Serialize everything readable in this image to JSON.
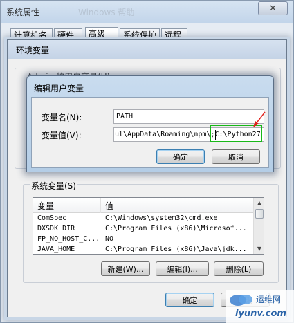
{
  "system_properties": {
    "title": "系统属性",
    "ghost_text": "Windows 帮助",
    "close_glyph": "✕",
    "tabs": [
      {
        "label": "计算机名"
      },
      {
        "label": "硬件"
      },
      {
        "label": "高级"
      },
      {
        "label": "系统保护"
      },
      {
        "label": "远程"
      }
    ],
    "active_tab": "高级"
  },
  "environment_variables": {
    "title": "环境变量",
    "user_group_label": "Admin 的用户变量(U)",
    "system_group_label": "系统变量(S)",
    "system_table": {
      "columns": [
        "变量",
        "值"
      ],
      "rows": [
        {
          "name": "ComSpec",
          "value": "C:\\Windows\\system32\\cmd.exe"
        },
        {
          "name": "DXSDK_DIR",
          "value": "C:\\Program Files (x86)\\Microsof..."
        },
        {
          "name": "FP_NO_HOST_C...",
          "value": "NO"
        },
        {
          "name": "JAVA_HOME",
          "value": "C:\\Program Files (x86)\\Java\\jdk..."
        }
      ]
    },
    "buttons": {
      "new": "新建(W)...",
      "edit": "编辑(I)...",
      "delete": "删除(L)",
      "ok": "确定",
      "cancel": "取消"
    }
  },
  "edit_user_variable": {
    "title": "编辑用户变量",
    "name_label": "变量名(N):",
    "name_value": "PATH",
    "value_label": "变量值(V):",
    "value_text": "ul\\AppData\\Roaming\\npm\\;C:\\Python27",
    "ok_label": "确定",
    "cancel_label": "取消"
  },
  "annotation": {
    "highlight_color": "#18b818",
    "arrow_color": "#e0201a"
  },
  "watermark": {
    "line1": "运维网",
    "line2": "iyunv.com"
  }
}
